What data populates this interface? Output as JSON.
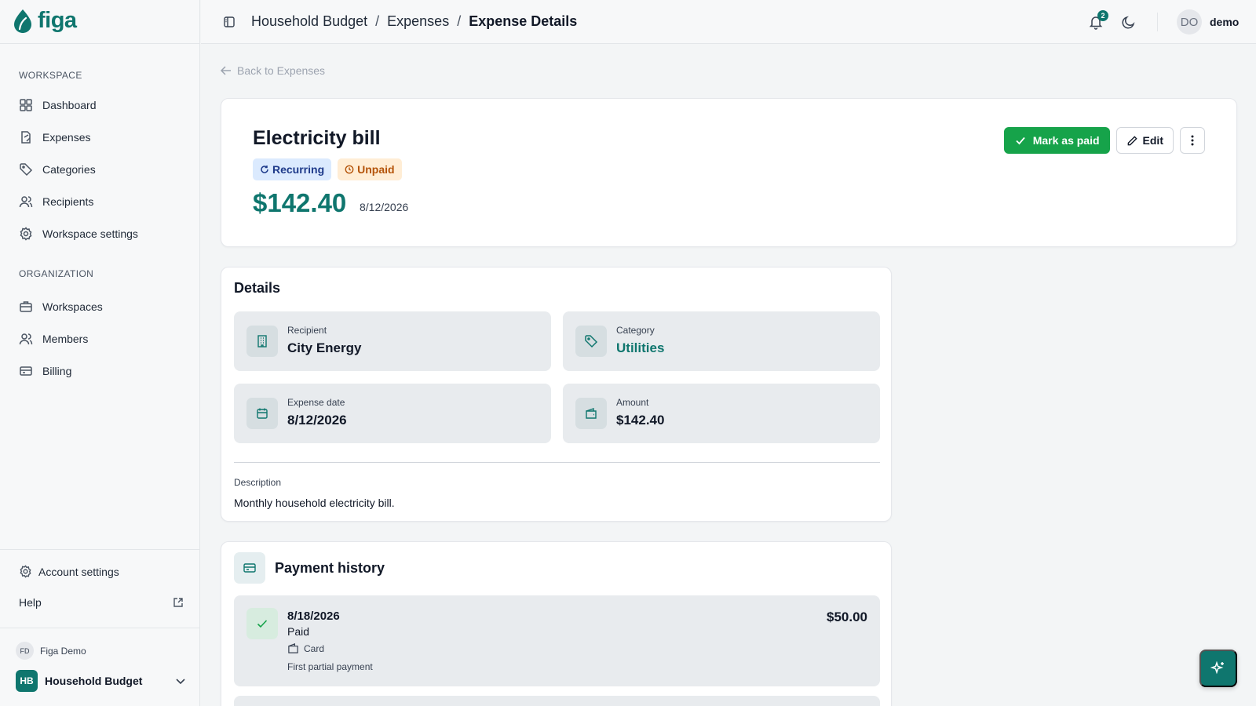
{
  "app": {
    "name": "figa",
    "accent": "#0f766e"
  },
  "sidebar": {
    "workspace_label": "WORKSPACE",
    "workspace_items": [
      {
        "label": "Dashboard",
        "icon": "grid-icon"
      },
      {
        "label": "Expenses",
        "icon": "receipt-icon"
      },
      {
        "label": "Categories",
        "icon": "tag-icon"
      },
      {
        "label": "Recipients",
        "icon": "users-icon"
      },
      {
        "label": "Workspace settings",
        "icon": "gear-icon"
      }
    ],
    "organization_label": "ORGANIZATION",
    "organization_items": [
      {
        "label": "Workspaces",
        "icon": "briefcase-icon"
      },
      {
        "label": "Members",
        "icon": "users-icon"
      },
      {
        "label": "Billing",
        "icon": "credit-card-icon"
      }
    ],
    "account_settings": "Account settings",
    "help": "Help",
    "user": {
      "initials": "FD",
      "name": "Figa Demo"
    },
    "workspace": {
      "initials": "HB",
      "name": "Household Budget"
    }
  },
  "topbar": {
    "breadcrumbs": [
      "Household Budget",
      "Expenses",
      "Expense Details"
    ],
    "separator": "/",
    "notifications_count": "2",
    "user": {
      "initials": "DO",
      "name": "demo"
    }
  },
  "back_link": "Back to Expenses",
  "expense": {
    "title": "Electricity bill",
    "badges": {
      "recurring": "Recurring",
      "status": "Unpaid"
    },
    "amount": "$142.40",
    "date": "8/12/2026",
    "actions": {
      "mark_paid": "Mark as paid",
      "edit": "Edit"
    }
  },
  "details": {
    "title": "Details",
    "fields": {
      "recipient": {
        "label": "Recipient",
        "value": "City Energy"
      },
      "category": {
        "label": "Category",
        "value": "Utilities"
      },
      "expense_date": {
        "label": "Expense date",
        "value": "8/12/2026"
      },
      "amount": {
        "label": "Amount",
        "value": "$142.40"
      }
    },
    "description_label": "Description",
    "description": "Monthly household electricity bill."
  },
  "payment_history": {
    "title": "Payment history",
    "items": [
      {
        "date": "8/18/2026",
        "status": "Paid",
        "method": "Card",
        "note": "First partial payment",
        "amount": "$50.00"
      }
    ]
  }
}
